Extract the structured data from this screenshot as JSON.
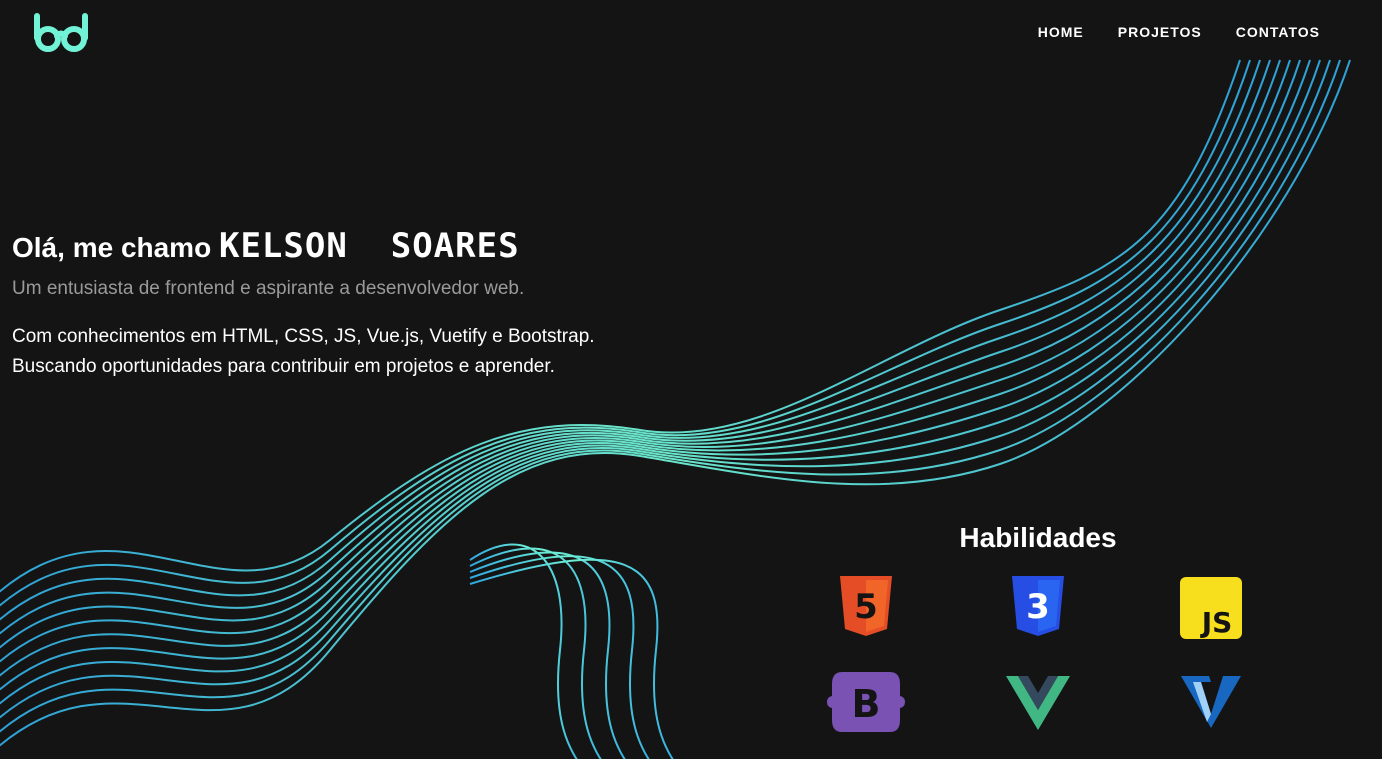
{
  "logo": {
    "icon": "glasses-icon",
    "color": "#72f2d6"
  },
  "nav": {
    "items": [
      {
        "label": "HOME"
      },
      {
        "label": "PROJETOS"
      },
      {
        "label": "CONTATOS"
      }
    ]
  },
  "hero": {
    "greeting": "Olá, me chamo",
    "name": "KELSON  SOARES",
    "subtitle": "Um entusiasta de frontend e aspirante a desenvolvedor web.",
    "description_line1": "Com conhecimentos em HTML, CSS, JS, Vue.js, Vuetify e Bootstrap.",
    "description_line2": "Buscando oportunidades para contribuir em projetos e aprender."
  },
  "skills": {
    "title": "Habilidades",
    "items": [
      {
        "icon": "html5-icon",
        "label": "5",
        "color": "#e44d26"
      },
      {
        "icon": "css3-icon",
        "label": "3",
        "color": "#264de4"
      },
      {
        "icon": "javascript-icon",
        "label": "JS",
        "color": "#f7df1e"
      },
      {
        "icon": "bootstrap-icon",
        "label": "B",
        "color": "#7952b3"
      },
      {
        "icon": "vuejs-icon",
        "color": "#41b883"
      },
      {
        "icon": "vuetify-icon",
        "color": "#1867c0"
      }
    ]
  },
  "colors": {
    "background": "#141414",
    "wave_start": "#2fa8e0",
    "wave_end": "#6ff0d4"
  }
}
